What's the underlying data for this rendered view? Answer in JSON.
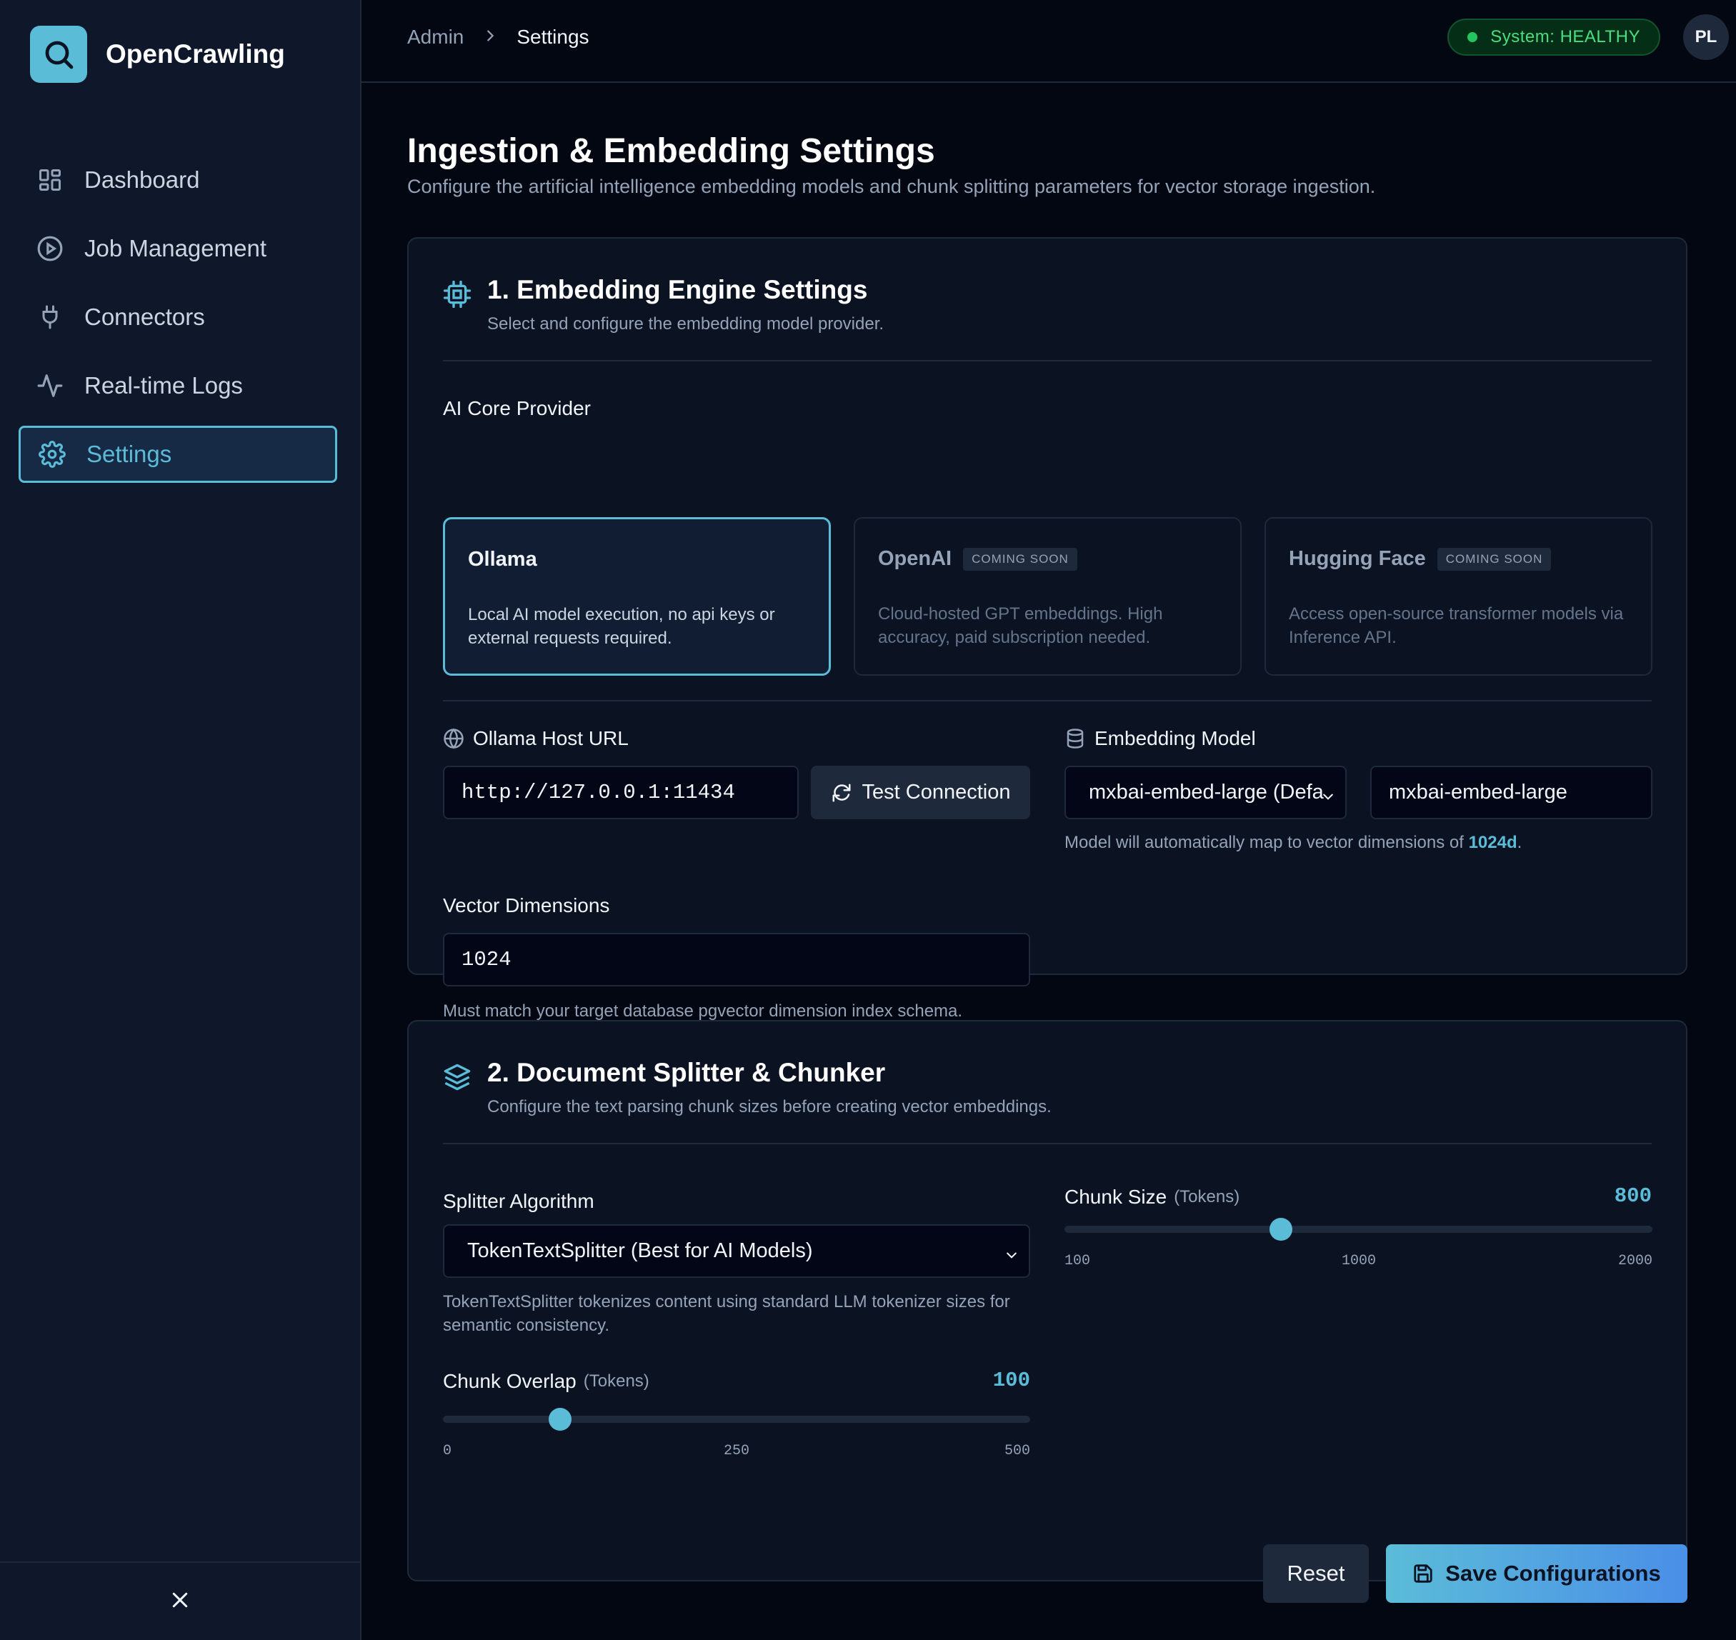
{
  "app": {
    "name": "OpenCrawling",
    "accent": "#5bbcd8"
  },
  "sidebar": {
    "items": [
      {
        "label": "Dashboard",
        "icon": "dashboard-grid-icon"
      },
      {
        "label": "Job Management",
        "icon": "play-circle-icon"
      },
      {
        "label": "Connectors",
        "icon": "plug-icon"
      },
      {
        "label": "Real-time Logs",
        "icon": "activity-icon"
      },
      {
        "label": "Settings",
        "icon": "gear-icon",
        "active": true
      }
    ]
  },
  "header": {
    "breadcrumb": [
      "Admin",
      "Settings"
    ],
    "status": "System: HEALTHY",
    "status_color": "#22c55e",
    "avatar_initials": "PL"
  },
  "page": {
    "title": "Ingestion & Embedding Settings",
    "subtitle": "Configure the artificial intelligence embedding models and chunk splitting parameters for vector storage ingestion."
  },
  "embedding": {
    "title": "1. Embedding Engine Settings",
    "subtitle": "Select and configure the embedding model provider.",
    "provider_label": "AI Core Provider",
    "providers": [
      {
        "name": "Ollama",
        "badge": "",
        "desc": "Local AI model execution, no api keys or external requests required.",
        "selected": true
      },
      {
        "name": "OpenAI",
        "badge": "COMING SOON",
        "desc": "Cloud-hosted GPT embeddings. High accuracy, paid subscription needed.",
        "selected": false
      },
      {
        "name": "Hugging Face",
        "badge": "COMING SOON",
        "desc": "Access open-source transformer models via Inference API.",
        "selected": false
      }
    ],
    "host_label": "Ollama Host URL",
    "host_value": "http://127.0.0.1:11434",
    "test_button": "Test Connection",
    "model_label": "Embedding Model",
    "model_select": "mxbai-embed-large (Defa",
    "model_value": "mxbai-embed-large",
    "model_help_prefix": "Model will automatically map to vector dimensions of ",
    "model_help_dim": "1024d",
    "model_help_suffix": ".",
    "dims_label": "Vector Dimensions",
    "dims_value": "1024",
    "dims_help": "Must match your target database pgvector dimension index schema."
  },
  "splitter": {
    "title": "2. Document Splitter & Chunker",
    "subtitle": "Configure the text parsing chunk sizes before creating vector embeddings.",
    "algo_label": "Splitter Algorithm",
    "algo_value": "TokenTextSplitter (Best for AI Models)",
    "algo_help": "TokenTextSplitter tokenizes content using standard LLM tokenizer sizes for semantic consistency.",
    "chunk_size": {
      "label": "Chunk Size",
      "unit": "(Tokens)",
      "value": 800,
      "display": "800",
      "min": 100,
      "max": 2000,
      "ticks": [
        "100",
        "1000",
        "2000"
      ]
    },
    "chunk_overlap": {
      "label": "Chunk Overlap",
      "unit": "(Tokens)",
      "value": 100,
      "display": "100",
      "min": 0,
      "max": 500,
      "ticks": [
        "0",
        "250",
        "500"
      ]
    }
  },
  "actions": {
    "reset": "Reset",
    "save": "Save Configurations"
  }
}
